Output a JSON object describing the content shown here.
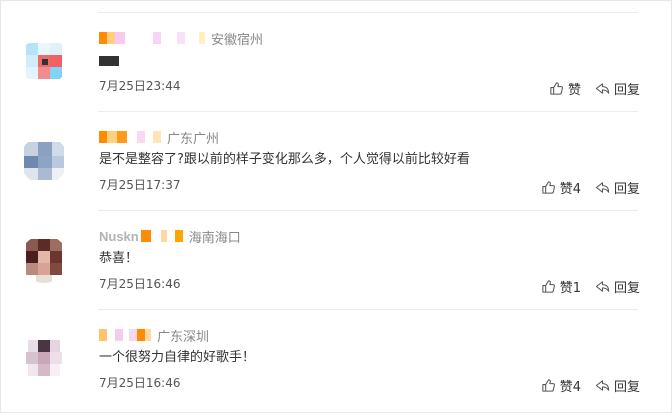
{
  "colors": {
    "text": "#333333",
    "meta": "#888888",
    "divider": "#ececec"
  },
  "comments": [
    {
      "location": "安徽宿州",
      "text": "",
      "time": "7月25日23:44",
      "like_label": "赞",
      "reply_label": "回复",
      "like_icon": "thumbs-up-icon",
      "reply_icon": "reply-arrow-icon"
    },
    {
      "location": "广东广州",
      "text": "是不是整容了?跟以前的样子变化那么多，个人觉得以前比较好看",
      "time": "7月25日17:37",
      "like_label": "赞4",
      "reply_label": "回复",
      "like_icon": "thumbs-up-icon",
      "reply_icon": "reply-arrow-icon"
    },
    {
      "name": "Nuskn",
      "location": "海南海口",
      "text": "恭喜！",
      "time": "7月25日16:46",
      "like_label": "赞1",
      "reply_label": "回复",
      "like_icon": "thumbs-up-icon",
      "reply_icon": "reply-arrow-icon"
    },
    {
      "location": "广东深圳",
      "text": "一个很努力自律的好歌手！",
      "time": "7月25日16:46",
      "like_label": "赞4",
      "reply_label": "回复",
      "like_icon": "thumbs-up-icon",
      "reply_icon": "reply-arrow-icon"
    }
  ]
}
